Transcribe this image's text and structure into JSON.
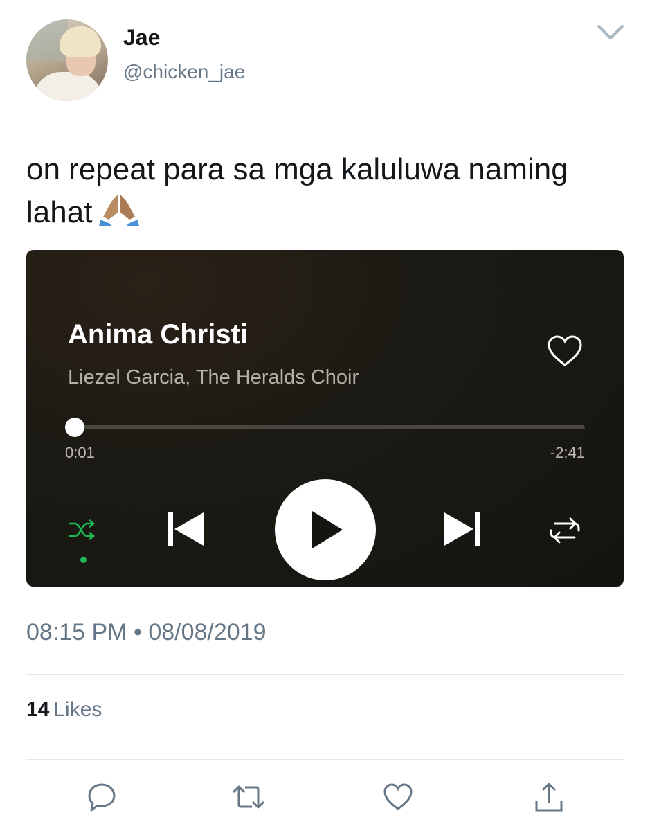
{
  "tweet": {
    "user": {
      "name": "Jae",
      "handle": "@chicken_jae"
    },
    "text": "on repeat para sa mga kaluluwa naming lahat",
    "emoji": "folded-hands-icon",
    "timestamp": "08:15 PM • 08/08/2019",
    "likes_count": "14",
    "likes_label": "Likes"
  },
  "player": {
    "title": "Anima Christi",
    "artist": "Liezel Garcia, The Heralds Choir",
    "elapsed": "0:01",
    "remaining": "-2:41",
    "progress_fraction": 0.006,
    "shuffle_active": true,
    "controls": [
      "shuffle-icon",
      "previous-icon",
      "play-icon",
      "next-icon",
      "repeat-icon"
    ]
  },
  "actions": [
    "reply-icon",
    "retweet-icon",
    "like-icon",
    "share-icon"
  ],
  "colors": {
    "accent_green": "#1db954",
    "secondary_text": "#657786",
    "player_bg": "#1c1a14"
  }
}
